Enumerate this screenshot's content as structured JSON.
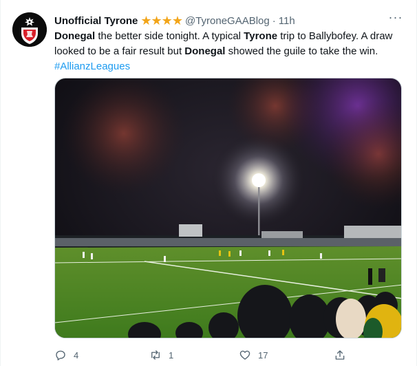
{
  "author": {
    "name": "Unofficial Tyrone",
    "stars": "★★★★",
    "handle": "@TyroneGAABlog",
    "separator": "·",
    "time": "11h"
  },
  "more_label": "···",
  "body": {
    "w1": "Donegal",
    "t1": " the better side tonight. A typical ",
    "w2": "Tyrone",
    "t2": " trip to Ballybofey. A draw looked to be a fair result but ",
    "w3": "Donegal",
    "t3": " showed the guile to take the win.",
    "hashtag": "#AllianzLeagues"
  },
  "actions": {
    "replies": "4",
    "retweets": "1",
    "likes": "17"
  },
  "colors": {
    "accent": "#1d9bf0",
    "muted": "#536471",
    "star": "#f2a51a"
  }
}
